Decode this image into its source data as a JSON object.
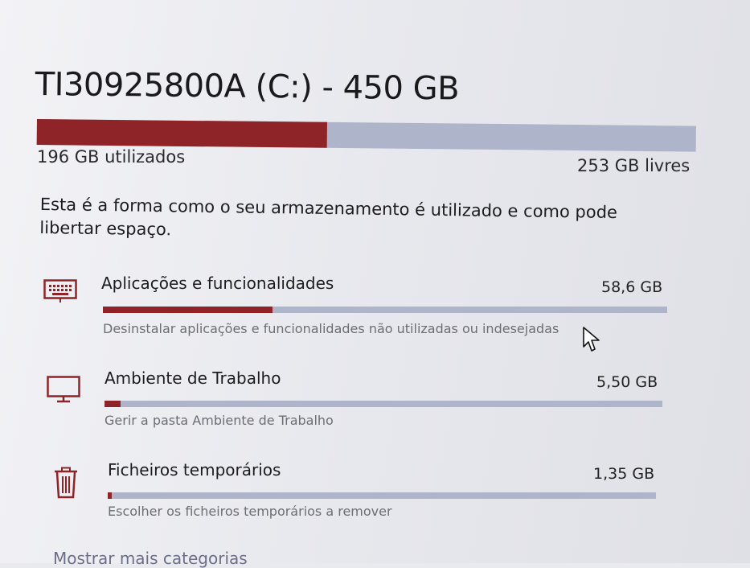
{
  "drive": {
    "title": "TI30925800A (C:) - 450 GB",
    "used_fraction": 0.44,
    "used_label": "196 GB utilizados",
    "free_label": "253 GB livres"
  },
  "description": "Esta é a forma como o seu armazenamento é utilizado e como pode libertar espaço.",
  "categories": [
    {
      "icon": "keyboard-icon",
      "name": "Aplicações e funcionalidades",
      "size": "58,6 GB",
      "fraction": 0.3,
      "subtext": "Desinstalar aplicações e funcionalidades não utilizadas ou indesejadas"
    },
    {
      "icon": "monitor-icon",
      "name": "Ambiente de Trabalho",
      "size": "5,50 GB",
      "fraction": 0.029,
      "subtext": "Gerir a pasta Ambiente de Trabalho"
    },
    {
      "icon": "trash-icon",
      "name": "Ficheiros temporários",
      "size": "1,35 GB",
      "fraction": 0.007,
      "subtext": "Escolher os ficheiros temporários a remover"
    }
  ],
  "more_link": "Mostrar mais categorias",
  "colors": {
    "accent": "#8e2427",
    "bar_track": "#aeb4c9",
    "link": "#6a6e88"
  }
}
